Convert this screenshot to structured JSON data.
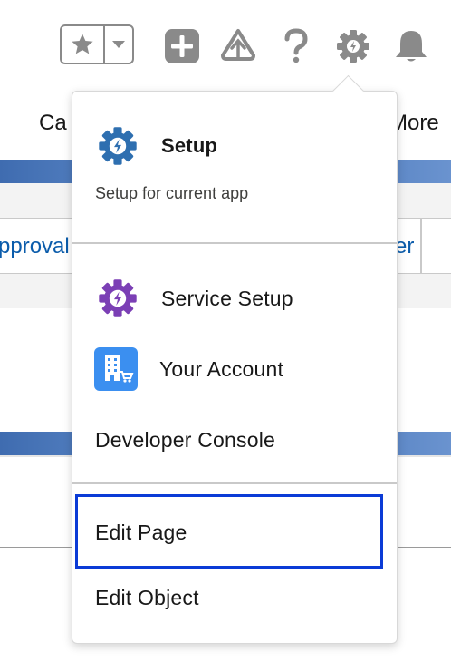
{
  "background": {
    "nav_left": "Ca",
    "nav_right": "More",
    "link_left": "pproval",
    "link_right": "er"
  },
  "menu": {
    "setup": {
      "title": "Setup",
      "subtitle": "Setup for current app",
      "icon": "gear-lightning-icon"
    },
    "items": [
      {
        "label": "Service Setup",
        "icon": "gear-lightning-purple-icon"
      },
      {
        "label": "Your Account",
        "icon": "building-cart-icon"
      },
      {
        "label": "Developer Console"
      },
      {
        "label": "Edit Page",
        "focused": true
      },
      {
        "label": "Edit Object"
      }
    ]
  },
  "colors": {
    "setup_icon": "#2e6fb0",
    "service_icon": "#7b3fb5",
    "account_icon": "#3b8ff0",
    "focus": "#0b3bd6",
    "header_icon": "#8a8a8a"
  }
}
